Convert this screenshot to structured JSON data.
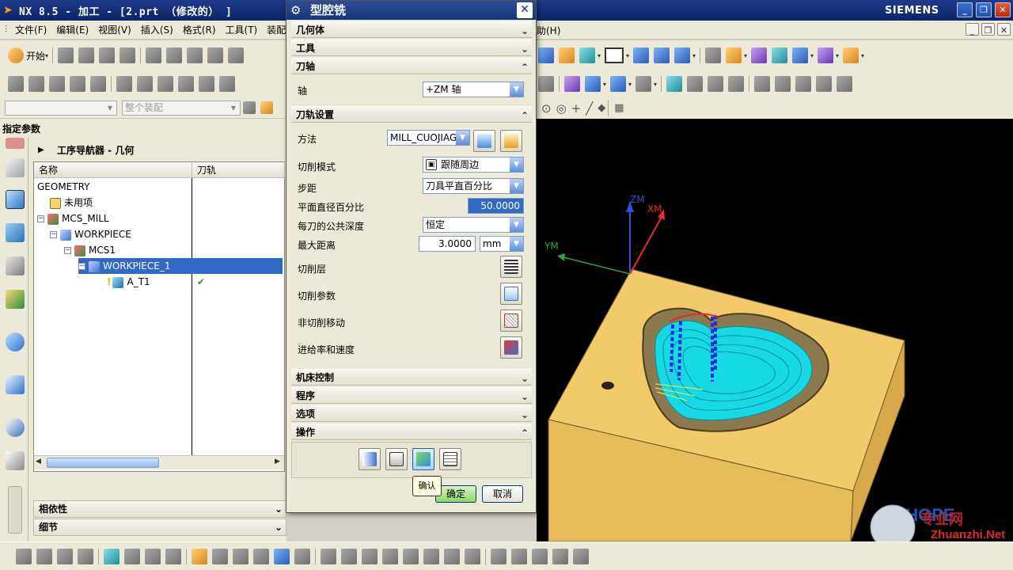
{
  "window": {
    "title": "NX 8.5 - 加工 - [2.prt （修改的） ]",
    "brand": "SIEMENS"
  },
  "menubar": {
    "items": [
      "文件(F)",
      "编辑(E)",
      "视图(V)",
      "插入(S)",
      "格式(R)",
      "工具(T)",
      "装配("
    ],
    "help_tail": "助(H)"
  },
  "toolbar": {
    "start_label": "开始",
    "assembly_placeholder": "整个装配"
  },
  "left_panel": {
    "title": "指定参数",
    "navigator_title": "工序导航器 - 几何",
    "columns": {
      "name": "名称",
      "toolpath": "刀轨"
    },
    "tree": [
      {
        "label": "GEOMETRY"
      },
      {
        "label": "未用项"
      },
      {
        "label": "MCS_MILL"
      },
      {
        "label": "WORKPIECE"
      },
      {
        "label": "MCS1"
      },
      {
        "label": "WORKPIECE_1"
      },
      {
        "label": "A_T1",
        "toolpath_status": "✔"
      }
    ],
    "dependencies": "相依性",
    "details": "细节"
  },
  "dialog": {
    "title": "型腔铣",
    "sections": {
      "geometry": "几何体",
      "tool": "工具",
      "tool_axis": "刀轴",
      "path_settings": "刀轨设置",
      "machine_control": "机床控制",
      "program": "程序",
      "options": "选项",
      "actions": "操作"
    },
    "axis_label": "轴",
    "axis_value": "+ZM 轴",
    "method_label": "方法",
    "method_value": "MILL_CUOJIAG",
    "cut_pattern_label": "切削模式",
    "cut_pattern_value": "跟随周边",
    "stepover_label": "步距",
    "stepover_value": "刀具平直百分比",
    "flat_percent_label": "平面直径百分比",
    "flat_percent_value": "50.0000",
    "depth_label": "每刀的公共深度",
    "depth_value": "恒定",
    "max_distance_label": "最大距离",
    "max_distance_value": "3.0000",
    "max_distance_unit": "mm",
    "cut_levels_label": "切削层",
    "cut_params_label": "切削参数",
    "noncut_label": "非切削移动",
    "feeds_label": "进给率和速度",
    "ok_label": "确定",
    "cancel_label": "取消",
    "tooltip": "确认"
  },
  "viewport": {
    "axis_zm": "ZM",
    "axis_xm": "XM",
    "axis_ym": "YM",
    "watermark_brand": "GOHOPE",
    "watermark_site": "Zhuanzhi.Net",
    "watermark_cn": "专业网"
  },
  "colors": {
    "title_bar": "#16337a",
    "selection": "#316ac5",
    "part_body": "#f2c96b",
    "toolpath": "#17d9e6"
  }
}
